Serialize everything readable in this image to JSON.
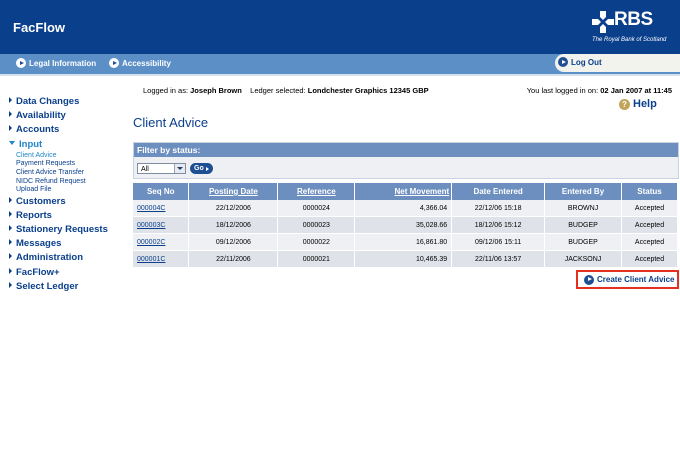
{
  "app": {
    "title": "FacFlow"
  },
  "logo": {
    "name": "RBS",
    "subtitle": "The Royal Bank of Scotland"
  },
  "nav": {
    "items": [
      {
        "label": "Legal Information"
      },
      {
        "label": "Accessibility"
      }
    ],
    "logout_label": "Log Out"
  },
  "sidebar": {
    "items": [
      {
        "label": "Data Changes"
      },
      {
        "label": "Availability"
      },
      {
        "label": "Accounts"
      },
      {
        "label": "Input"
      },
      {
        "label": "Customers"
      },
      {
        "label": "Reports"
      },
      {
        "label": "Stationery Requests"
      },
      {
        "label": "Messages"
      },
      {
        "label": "Administration"
      },
      {
        "label": "FacFlow+"
      },
      {
        "label": "Select Ledger"
      }
    ],
    "input_sub": [
      {
        "label": "Client Advice"
      },
      {
        "label": "Payment Requests"
      },
      {
        "label": "Client Advice Transfer"
      },
      {
        "label": "NIDC Refund Request"
      },
      {
        "label": "Upload File"
      }
    ]
  },
  "session": {
    "logged_in_label": "Logged in as:",
    "user": "Joseph Brown",
    "ledger_label": "Ledger selected:",
    "ledger": "Londchester Graphics  12345  GBP",
    "last_login_label": "You last logged in on:",
    "last_login": "02 Jan 2007 at 11:45"
  },
  "help_label": "Help",
  "help_icon": "?",
  "page_title": "Client Advice",
  "filter": {
    "heading": "Filter by status:",
    "selected": "All",
    "go_label": "Go"
  },
  "table": {
    "headers": [
      "Seq No",
      "Posting Date",
      "Reference",
      "Net Movement",
      "Date Entered",
      "Entered By",
      "Status"
    ],
    "rows": [
      [
        "000004C",
        "22/12/2006",
        "0000024",
        "4,366.04",
        "22/12/06 15:18",
        "BROWNJ",
        "Accepted"
      ],
      [
        "000003C",
        "18/12/2006",
        "0000023",
        "35,028.66",
        "18/12/06 15:12",
        "BUDGEP",
        "Accepted"
      ],
      [
        "000002C",
        "09/12/2006",
        "0000022",
        "16,861.80",
        "09/12/06 15:11",
        "BUDGEP",
        "Accepted"
      ],
      [
        "000001C",
        "22/11/2006",
        "0000021",
        "10,465.39",
        "22/11/06 13:57",
        "JACKSONJ",
        "Accepted"
      ]
    ]
  },
  "create_label": "Create Client Advice",
  "colors": {
    "header_blue": "#0a3f8c",
    "nav_blue": "#5b8fc6",
    "table_header": "#6d8fbf",
    "highlight": "#e53020"
  }
}
